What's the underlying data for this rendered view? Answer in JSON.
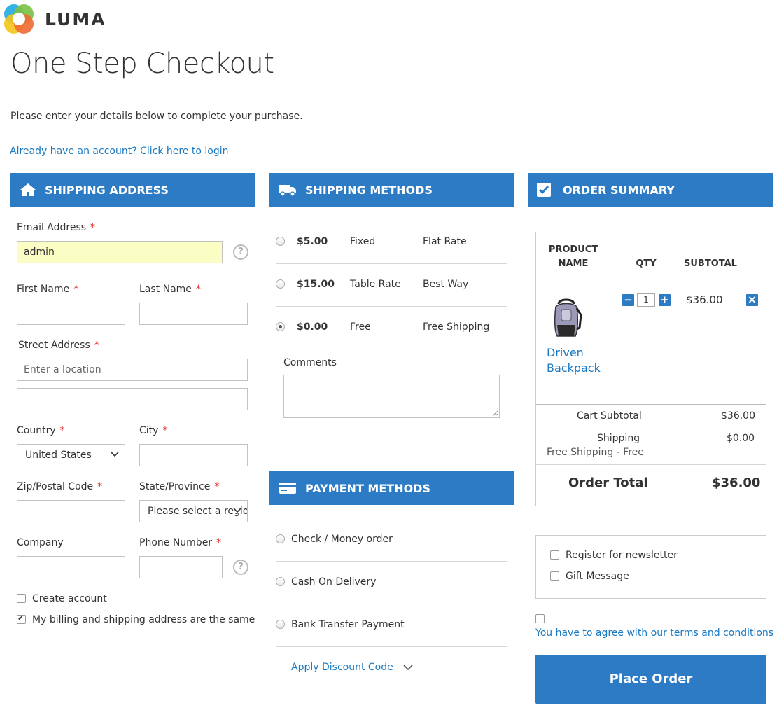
{
  "brand": {
    "name": "LUMA"
  },
  "page": {
    "title": "One Step Checkout",
    "intro": "Please enter your details below to complete your purchase.",
    "login_link": "Already have an account? Click here to login"
  },
  "shipping_address": {
    "heading": "SHIPPING ADDRESS",
    "email_label": "Email Address",
    "email_value": "admin",
    "first_name_label": "First Name",
    "last_name_label": "Last Name",
    "street_label": "Street Address",
    "street_placeholder": "Enter a location",
    "country_label": "Country",
    "country_value": "United States",
    "city_label": "City",
    "zip_label": "Zip/Postal Code",
    "state_label": "State/Province",
    "state_value": "Please select a region, state or province.",
    "company_label": "Company",
    "phone_label": "Phone Number",
    "required_marker": "*",
    "help_glyph": "?",
    "create_account_label": "Create account",
    "create_account_checked": false,
    "billing_same_label": "My billing and shipping address are the same",
    "billing_same_checked": true
  },
  "shipping_methods": {
    "heading": "SHIPPING METHODS",
    "options": [
      {
        "price": "$5.00",
        "method": "Fixed",
        "carrier": "Flat Rate",
        "selected": false
      },
      {
        "price": "$15.00",
        "method": "Table Rate",
        "carrier": "Best Way",
        "selected": false
      },
      {
        "price": "$0.00",
        "method": "Free",
        "carrier": "Free Shipping",
        "selected": true
      }
    ],
    "comments_label": "Comments"
  },
  "payment_methods": {
    "heading": "PAYMENT METHODS",
    "options": [
      {
        "label": "Check / Money order"
      },
      {
        "label": "Cash On Delivery"
      },
      {
        "label": "Bank Transfer Payment"
      }
    ],
    "discount_link": "Apply Discount Code"
  },
  "order_summary": {
    "heading": "ORDER SUMMARY",
    "columns": {
      "product": "PRODUCT NAME",
      "qty": "QTY",
      "subtotal": "SUBTOTAL"
    },
    "items": [
      {
        "name": "Driven Backpack",
        "qty": "1",
        "subtotal": "$36.00"
      }
    ],
    "cart_subtotal_label": "Cart Subtotal",
    "cart_subtotal_value": "$36.00",
    "shipping_label": "Shipping",
    "shipping_value": "$0.00",
    "shipping_detail": "Free Shipping - Free",
    "order_total_label": "Order Total",
    "order_total_value": "$36.00",
    "newsletter_label": "Register for newsletter",
    "gift_message_label": "Gift Message",
    "terms_label": "You have to agree with our terms and conditions",
    "place_order_label": "Place Order",
    "qty_minus": "−",
    "qty_plus": "+",
    "remove_glyph": "×"
  },
  "colors": {
    "accent": "#2d7bc4",
    "link": "#1979c3",
    "required": "#e02b27",
    "email_highlight": "#fafdc4"
  }
}
